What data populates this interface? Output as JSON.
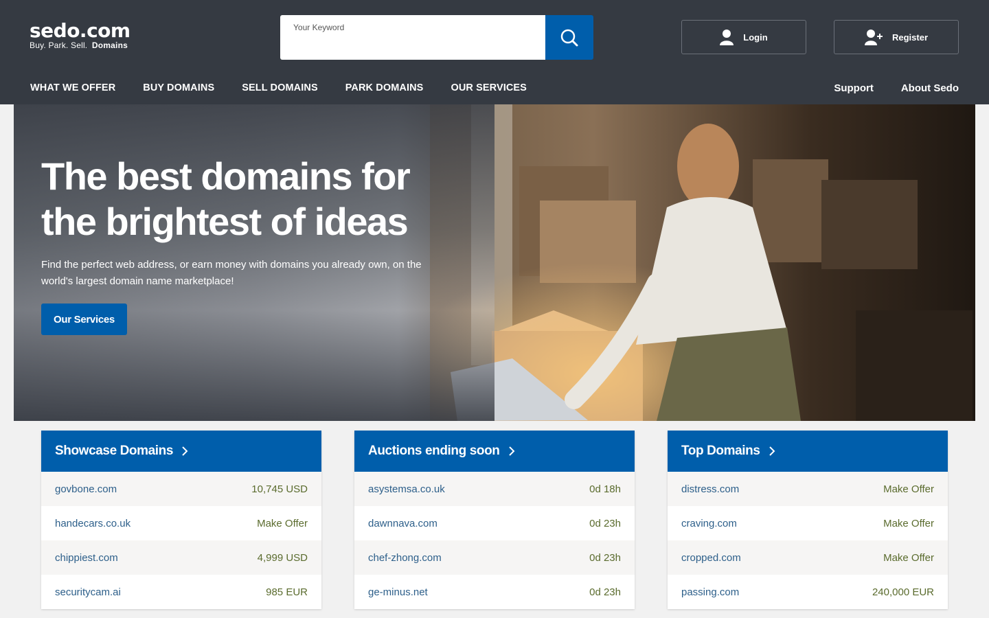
{
  "logo": {
    "main": "sedo.com",
    "tagline": "Buy.  Park.  Sell.",
    "tagline_bold": "Domains"
  },
  "search": {
    "label": "Your Keyword",
    "value": "",
    "placeholder": ""
  },
  "auth": {
    "login": "Login",
    "register": "Register"
  },
  "nav": {
    "left": [
      "WHAT WE OFFER",
      "BUY DOMAINS",
      "SELL DOMAINS",
      "PARK DOMAINS",
      "OUR SERVICES"
    ],
    "right": [
      "Support",
      "About Sedo"
    ]
  },
  "hero": {
    "title": "The best domains for the brightest of ideas",
    "text": "Find the perfect web address, or earn money with domains you already own, on the world's largest domain name marketplace!",
    "cta": "Our Services"
  },
  "panels": [
    {
      "title": "Showcase Domains",
      "rows": [
        {
          "domain": "govbone.com",
          "value": "10,745 USD"
        },
        {
          "domain": "handecars.co.uk",
          "value": "Make Offer"
        },
        {
          "domain": "chippiest.com",
          "value": "4,999 USD"
        },
        {
          "domain": "securitycam.ai",
          "value": "985 EUR"
        }
      ]
    },
    {
      "title": "Auctions ending soon",
      "rows": [
        {
          "domain": "asystemsa.co.uk",
          "value": "0d 18h"
        },
        {
          "domain": "dawnnava.com",
          "value": "0d 23h"
        },
        {
          "domain": "chef-zhong.com",
          "value": "0d 23h"
        },
        {
          "domain": "ge-minus.net",
          "value": "0d 23h"
        }
      ]
    },
    {
      "title": "Top Domains",
      "rows": [
        {
          "domain": "distress.com",
          "value": "Make Offer"
        },
        {
          "domain": "craving.com",
          "value": "Make Offer"
        },
        {
          "domain": "cropped.com",
          "value": "Make Offer"
        },
        {
          "domain": "passing.com",
          "value": "240,000 EUR"
        }
      ]
    }
  ],
  "colors": {
    "header": "#353a42",
    "accent": "#005eab",
    "link": "#2d5f8a",
    "value": "#5a6b2d"
  },
  "icons": {
    "search": "search-icon",
    "login": "user-icon",
    "register": "user-plus-icon",
    "panel": "chevron-right-icon"
  }
}
